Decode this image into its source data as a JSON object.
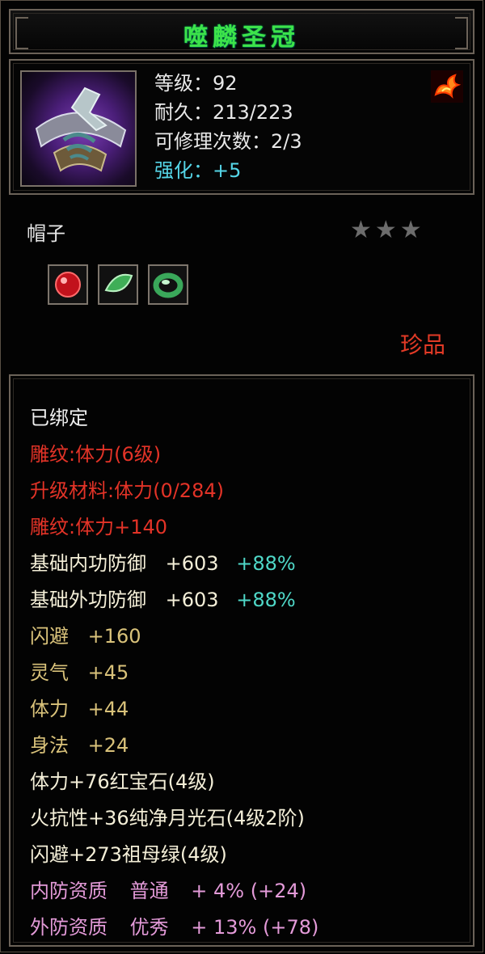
{
  "title": "噬麟圣冠",
  "item": {
    "icon": "helmet-crown-icon",
    "level_label": "等级：92",
    "durability_label": "耐久：213/223",
    "repair_label": "可修理次数：2/3",
    "enhance_label": "强化：+5",
    "element_icon": "fire-phoenix-icon",
    "slot_name": "帽子",
    "stars": "★★★",
    "gems": [
      "ruby-gem-icon",
      "jade-gem-icon",
      "emerald-ring-icon"
    ],
    "rarity": "珍品"
  },
  "attributes": {
    "bound": "已绑定",
    "carve": "雕纹:体力(6级)",
    "upgrade": "升级材料:体力(0/284)",
    "carve_bonus": "雕纹:体力+140",
    "inner_def": "基础内功防御",
    "inner_def_val": "+603",
    "inner_def_pct": "+88%",
    "outer_def": "基础外功防御",
    "outer_def_val": "+603",
    "outer_def_pct": "+88%",
    "dodge": "闪避",
    "dodge_val": "+160",
    "spirit": "灵气",
    "spirit_val": "+45",
    "stamina": "体力",
    "stamina_val": "+44",
    "agility": "身法",
    "agility_val": "+24",
    "gem1": "体力+76红宝石(4级)",
    "gem2": "火抗性+36纯净月光石(4级2阶)",
    "gem3": "闪避+273祖母绿(4级)",
    "inner_quality": "内防资质",
    "inner_quality_grade": "普通",
    "inner_quality_val": "+ 4% (+24)",
    "outer_quality": "外防资质",
    "outer_quality_grade": "优秀",
    "outer_quality_val": "+ 13% (+78)"
  }
}
